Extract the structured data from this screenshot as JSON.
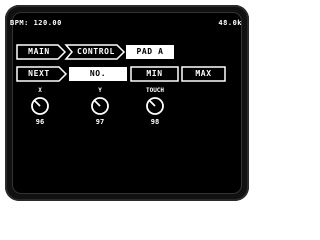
{
  "status": {
    "bpm": "BPM: 120.00",
    "rate": "48.0k"
  },
  "breadcrumb": {
    "main": "MAIN",
    "control": "CONTROL",
    "pad": "PAD A"
  },
  "params": {
    "next": "NEXT",
    "no": "NO.",
    "min": "MIN",
    "max": "MAX"
  },
  "knobs": [
    {
      "label": "X",
      "value": "96"
    },
    {
      "label": "Y",
      "value": "97"
    },
    {
      "label": "TOUCH",
      "value": "98"
    }
  ],
  "colors": {
    "screen": "#000000",
    "fg": "#ffffff"
  }
}
